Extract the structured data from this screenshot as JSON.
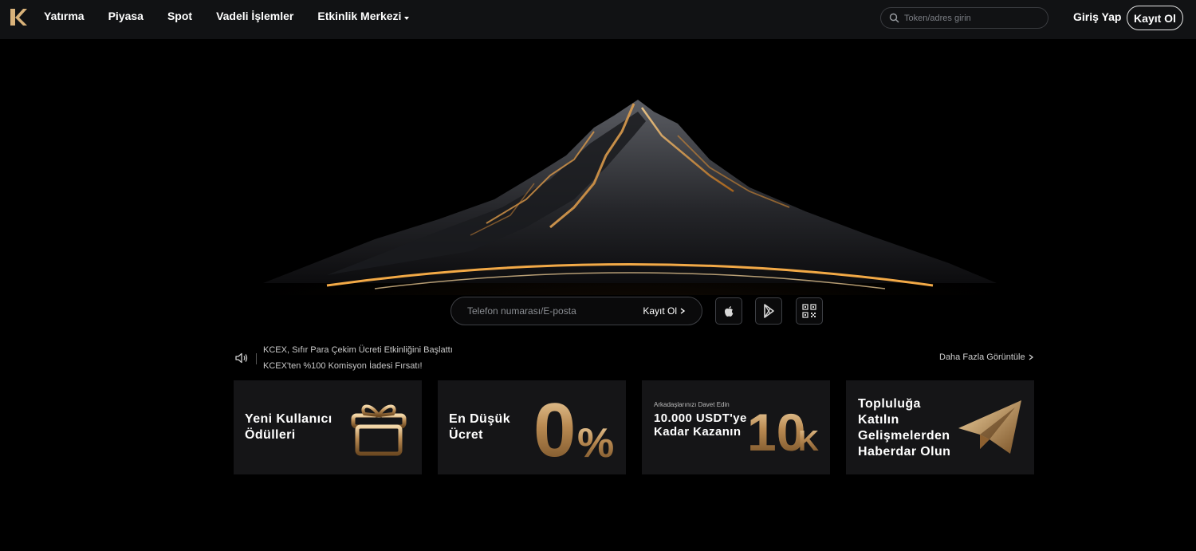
{
  "header": {
    "nav": [
      "Yatırma",
      "Piyasa",
      "Spot",
      "Vadeli İşlemler",
      "Etkinlik Merkezi"
    ],
    "search_placeholder": "Token/adres girin",
    "login": "Giriş Yap",
    "signup": "Kayıt Ol"
  },
  "hero": {
    "input_placeholder": "Telefon numarası/E-posta",
    "signup": "Kayıt Ol"
  },
  "announcements": {
    "items": [
      "KCEX, Sıfır Para Çekim Ücreti Etkinliğini Başlattı",
      "KCEX'ten %100 Komisyon İadesi Fırsatı!"
    ],
    "more": "Daha Fazla Görüntüle"
  },
  "cards": [
    {
      "title": "Yeni Kullanıcı Ödülleri",
      "graphic": "gift-icon"
    },
    {
      "title": "En Düşük Ücret",
      "graphic_text": "0",
      "graphic_suffix": "%"
    },
    {
      "subtitle": "Arkadaşlarınızı Davet Edin",
      "title": "10.000 USDT'ye Kadar Kazanın",
      "graphic_text": "10",
      "graphic_suffix": "K"
    },
    {
      "title": "Topluluğa Katılın Gelişmelerden Haberdar Olun",
      "graphic": "telegram-icon"
    }
  ],
  "colors": {
    "accent_gold": "#c99a5a",
    "header_bg": "#111214",
    "card_bg": "#151517"
  }
}
